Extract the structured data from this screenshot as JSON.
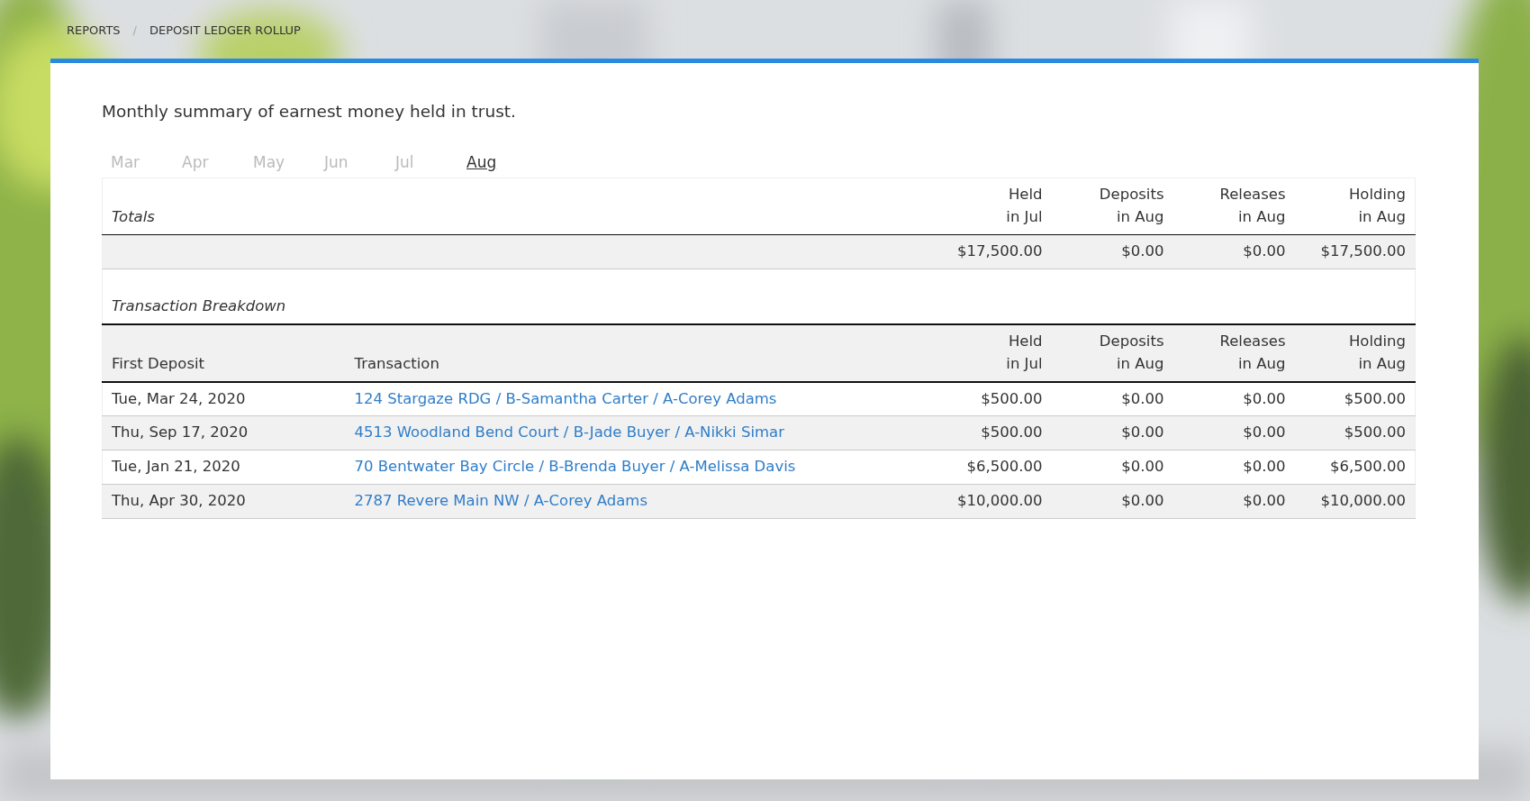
{
  "breadcrumb": {
    "items": [
      "REPORTS",
      "DEPOSIT LEDGER ROLLUP"
    ],
    "separator": "/"
  },
  "description": "Monthly summary of earnest money held in trust.",
  "months": [
    {
      "label": "Mar",
      "selected": false
    },
    {
      "label": "Apr",
      "selected": false
    },
    {
      "label": "May",
      "selected": false
    },
    {
      "label": "Jun",
      "selected": false
    },
    {
      "label": "Jul",
      "selected": false
    },
    {
      "label": "Aug",
      "selected": true
    }
  ],
  "totals": {
    "title": "Totals",
    "columns": [
      "Held\nin Jul",
      "Deposits\nin Aug",
      "Releases\nin Aug",
      "Holding\nin Aug"
    ],
    "values": [
      "$17,500.00",
      "$0.00",
      "$0.00",
      "$17,500.00"
    ]
  },
  "breakdown": {
    "title": "Transaction Breakdown",
    "columns": [
      "First Deposit",
      "Transaction",
      "Held\nin Jul",
      "Deposits\nin Aug",
      "Releases\nin Aug",
      "Holding\nin Aug"
    ],
    "rows": [
      {
        "cells": [
          "Tue, Mar 24, 2020",
          "124 Stargaze RDG / B-Samantha Carter / A-Corey Adams",
          "$500.00",
          "$0.00",
          "$0.00",
          "$500.00"
        ]
      },
      {
        "cells": [
          "Thu, Sep 17, 2020",
          "4513 Woodland Bend Court / B-Jade Buyer / A-Nikki Simar",
          "$500.00",
          "$0.00",
          "$0.00",
          "$500.00"
        ]
      },
      {
        "cells": [
          "Tue, Jan 21, 2020",
          "70 Bentwater Bay Circle / B-Brenda Buyer / A-Melissa Davis",
          "$6,500.00",
          "$0.00",
          "$0.00",
          "$6,500.00"
        ]
      },
      {
        "cells": [
          "Thu, Apr 30, 2020",
          "2787 Revere Main NW / A-Corey Adams",
          "$10,000.00",
          "$0.00",
          "$0.00",
          "$10,000.00"
        ]
      }
    ]
  }
}
